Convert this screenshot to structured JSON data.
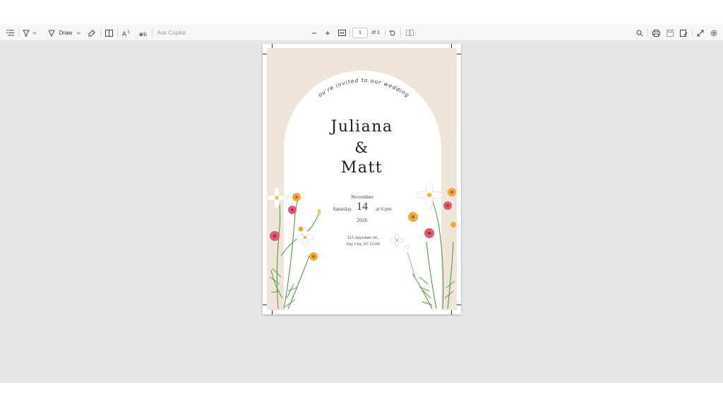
{
  "toolbar": {
    "draw_label": "Draw",
    "ask_copilot_label": "Ask Copilot",
    "page_current": "1",
    "page_total_label": "of 1"
  },
  "invitation": {
    "arc_text": "You're invited to our wedding!",
    "name1": "Juliana",
    "ampersand": "&",
    "name2": "Matt",
    "month": "November",
    "weekday": "Saturday",
    "day": "14",
    "time": "at 6 pm",
    "year": "2026",
    "address_line1": "123 Anywhere St.,",
    "address_line2": "Any City, ST 12345"
  },
  "colors": {
    "toolbar_bg": "#f7f7f7",
    "viewer_bg": "#e6e6e6",
    "card_beige": "#f0e5da",
    "arch_white": "#ffffff",
    "flower_pink": "#e05a74",
    "flower_orange": "#f0a93a",
    "leaf_green": "#4f8a3c"
  },
  "icons": [
    "contents-icon",
    "highlight-icon",
    "chevron-down-icon",
    "draw-icon",
    "eraser-icon",
    "page-view-icon",
    "read-aloud-icon",
    "translate-icon",
    "zoom-out-icon",
    "zoom-in-icon",
    "fit-page-icon",
    "rotate-icon",
    "two-page-icon",
    "search-icon",
    "print-icon",
    "save-icon",
    "save-as-icon",
    "fullscreen-icon",
    "settings-icon"
  ]
}
